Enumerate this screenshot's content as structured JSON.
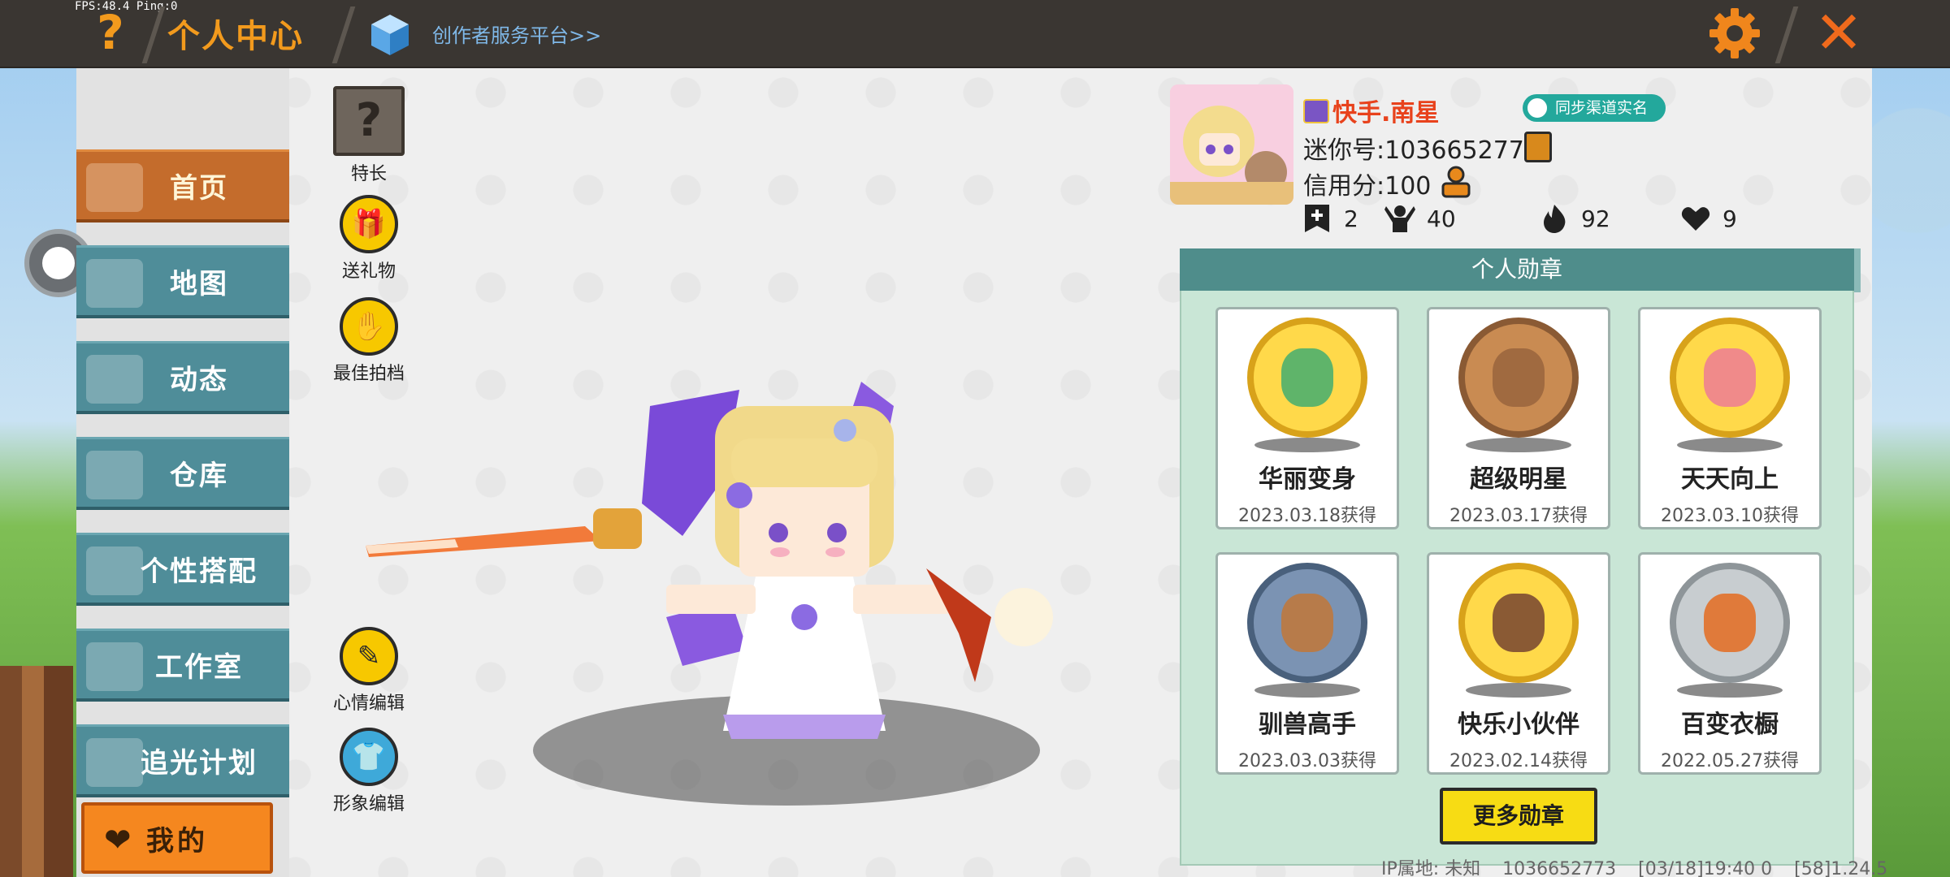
{
  "debug": {
    "fps_text": "FPS:48.4  Ping:0"
  },
  "header": {
    "title": "个人中心",
    "creator_link": "创作者服务平台>>",
    "icons": [
      "help-icon",
      "cube-icon",
      "gear-icon",
      "close-icon"
    ]
  },
  "sidebar": {
    "items": [
      {
        "label": "首页",
        "active": true
      },
      {
        "label": "地图"
      },
      {
        "label": "动态"
      },
      {
        "label": "仓库"
      },
      {
        "label": "个性搭配"
      },
      {
        "label": "工作室"
      },
      {
        "label": "追光计划"
      }
    ],
    "mine_label": "我的"
  },
  "actions": {
    "skill": "特长",
    "gift": "送礼物",
    "best_partner": "最佳拍档",
    "mood_edit": "心情编辑",
    "avatar_edit": "形象编辑"
  },
  "profile": {
    "nickname": "快手.南星",
    "sync_badge": "同步渠道实名",
    "mini_id": "迷你号:1036652773",
    "credit": "信用分:100",
    "stats": {
      "adds": "2",
      "fans": "40",
      "heat": "92",
      "likes": "9"
    }
  },
  "badges": {
    "header": "个人勋章",
    "items": [
      {
        "name": "华丽变身",
        "date": "2023.03.18获得",
        "tier": "gold"
      },
      {
        "name": "超级明星",
        "date": "2023.03.17获得",
        "tier": "bronze"
      },
      {
        "name": "天天向上",
        "date": "2023.03.10获得",
        "tier": "gold"
      },
      {
        "name": "驯兽高手",
        "date": "2023.03.03获得",
        "tier": "steel"
      },
      {
        "name": "快乐小伙伴",
        "date": "2023.02.14获得",
        "tier": "gold"
      },
      {
        "name": "百变衣橱",
        "date": "2022.05.27获得",
        "tier": "silver"
      }
    ],
    "more_label": "更多勋章"
  },
  "footer": {
    "ip_location": "IP属地: 未知",
    "uid": "1036652773",
    "timestamp": "[03/18]19:40 0",
    "version": "[58]1.24.5"
  },
  "colors": {
    "accent_orange": "#f29a1d",
    "nav_teal": "#4f8d99",
    "nav_active": "#c46c2c",
    "badge_panel": "#c9e6d6",
    "nickname_red": "#e8421c"
  }
}
